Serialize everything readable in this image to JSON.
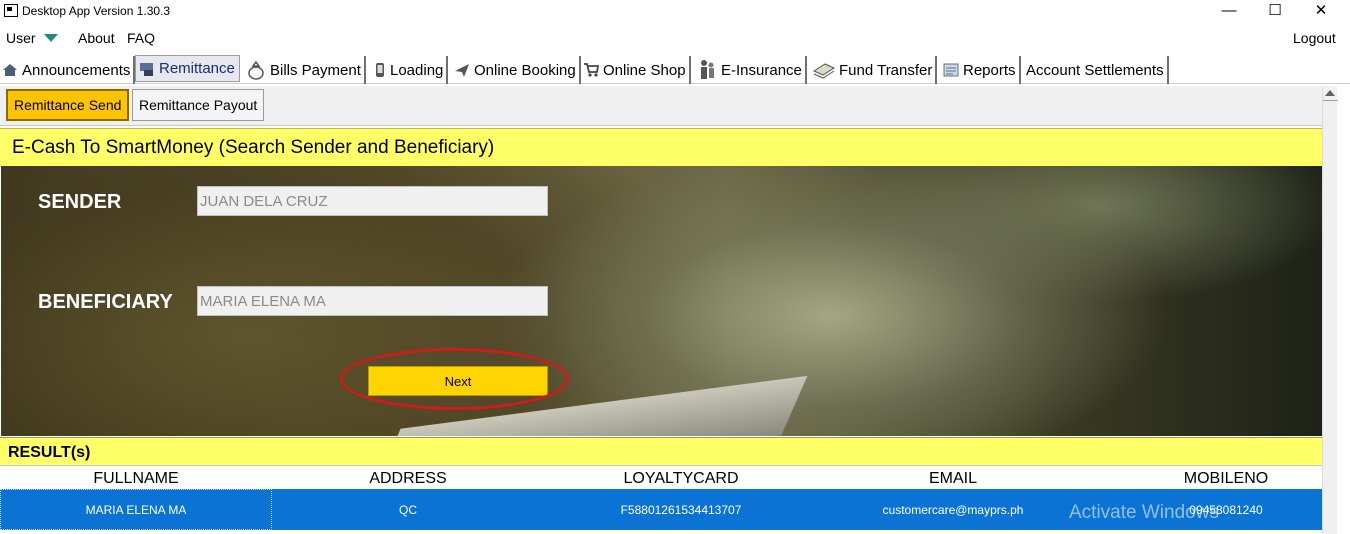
{
  "window": {
    "title": "Desktop App Version 1.30.3",
    "controls": {
      "minimize": "—",
      "maximize": "☐",
      "close": "✕"
    }
  },
  "menu": {
    "user": "User",
    "about": "About",
    "faq": "FAQ",
    "logout": "Logout"
  },
  "tabs": [
    {
      "label": "Announcements",
      "icon": "home-icon"
    },
    {
      "label": "Remittance",
      "icon": "remittance-icon",
      "active": true
    },
    {
      "label": "Bills Payment",
      "icon": "money-bag-icon"
    },
    {
      "label": "Loading",
      "icon": "phone-icon"
    },
    {
      "label": "Online Booking",
      "icon": "airplane-icon"
    },
    {
      "label": "Online Shop",
      "icon": "cart-icon"
    },
    {
      "label": "E-Insurance",
      "icon": "people-icon"
    },
    {
      "label": "Fund Transfer",
      "icon": "cash-stack-icon"
    },
    {
      "label": "Reports",
      "icon": "report-icon"
    },
    {
      "label": "Account Settlements",
      "icon": ""
    }
  ],
  "subtabs": [
    {
      "label": "Remittance Send",
      "selected": true
    },
    {
      "label": "Remittance Payout",
      "selected": false
    }
  ],
  "form": {
    "header": "E-Cash To SmartMoney (Search Sender and Beneficiary)",
    "sender_label": "SENDER",
    "sender_value": "JUAN DELA CRUZ",
    "beneficiary_label": "BENEFICIARY",
    "beneficiary_value": "MARIA ELENA MA",
    "next_label": "Next"
  },
  "results": {
    "header": "RESULT(s)",
    "columns": [
      "FULLNAME",
      "ADDRESS",
      "LOYALTYCARD",
      "EMAIL",
      "MOBILENO"
    ],
    "rows": [
      [
        "MARIA ELENA MA",
        "QC",
        "F58801261534413707",
        "customercare@mayprs.ph",
        "09458081240"
      ]
    ]
  },
  "watermark": "Activate Windows",
  "colors": {
    "highlight_yellow": "#ffff66",
    "button_yellow": "#ffd400",
    "selection_blue": "#0a73d4",
    "annotation_red": "#d11b1b"
  }
}
